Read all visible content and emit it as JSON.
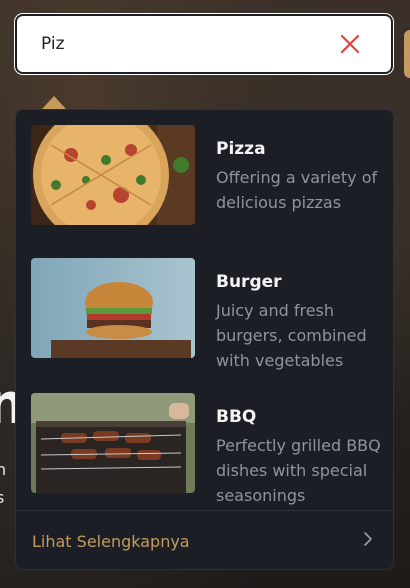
{
  "search": {
    "value": "Piz",
    "clear_icon": "close-icon",
    "clear_color": "#e2453d"
  },
  "background": {
    "heading_fragment": "n",
    "line_1": "n",
    "line_2": "s"
  },
  "results": [
    {
      "title": "Pizza",
      "description": "Offering a variety of delicious pizzas",
      "image": "pizza-image"
    },
    {
      "title": "Burger",
      "description": "Juicy and fresh burgers, combined with vegetables",
      "image": "burger-image"
    },
    {
      "title": "BBQ",
      "description": "Perfectly grilled BBQ dishes with special seasonings",
      "image": "bbq-image"
    }
  ],
  "footer": {
    "more_label": "Lihat Selengkapnya",
    "more_icon": "chevron-right-icon"
  },
  "colors": {
    "accent": "#c69a5c",
    "dropdown_bg": "#1b1f25",
    "title_text": "#f4f4f4",
    "desc_text": "#8f949b"
  }
}
